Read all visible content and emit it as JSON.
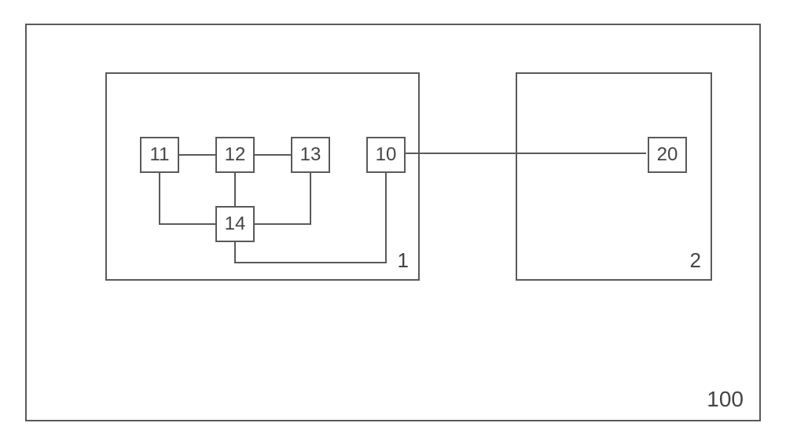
{
  "diagram": {
    "outer_label": "100",
    "group_1_label": "1",
    "group_2_label": "2",
    "nodes": {
      "n11": "11",
      "n12": "12",
      "n13": "13",
      "n10": "10",
      "n14": "14",
      "n20": "20"
    }
  },
  "chart_data": {
    "type": "diagram",
    "title": "",
    "containers": [
      {
        "id": "100",
        "parent": null
      },
      {
        "id": "1",
        "parent": "100"
      },
      {
        "id": "2",
        "parent": "100"
      }
    ],
    "nodes": [
      {
        "id": "11",
        "container": "1"
      },
      {
        "id": "12",
        "container": "1"
      },
      {
        "id": "13",
        "container": "1"
      },
      {
        "id": "14",
        "container": "1"
      },
      {
        "id": "10",
        "container": "1"
      },
      {
        "id": "20",
        "container": "2"
      }
    ],
    "edges": [
      {
        "from": "11",
        "to": "12"
      },
      {
        "from": "12",
        "to": "13"
      },
      {
        "from": "12",
        "to": "14"
      },
      {
        "from": "11",
        "to": "14"
      },
      {
        "from": "13",
        "to": "14"
      },
      {
        "from": "14",
        "to": "10"
      },
      {
        "from": "10",
        "to": "20"
      }
    ]
  }
}
